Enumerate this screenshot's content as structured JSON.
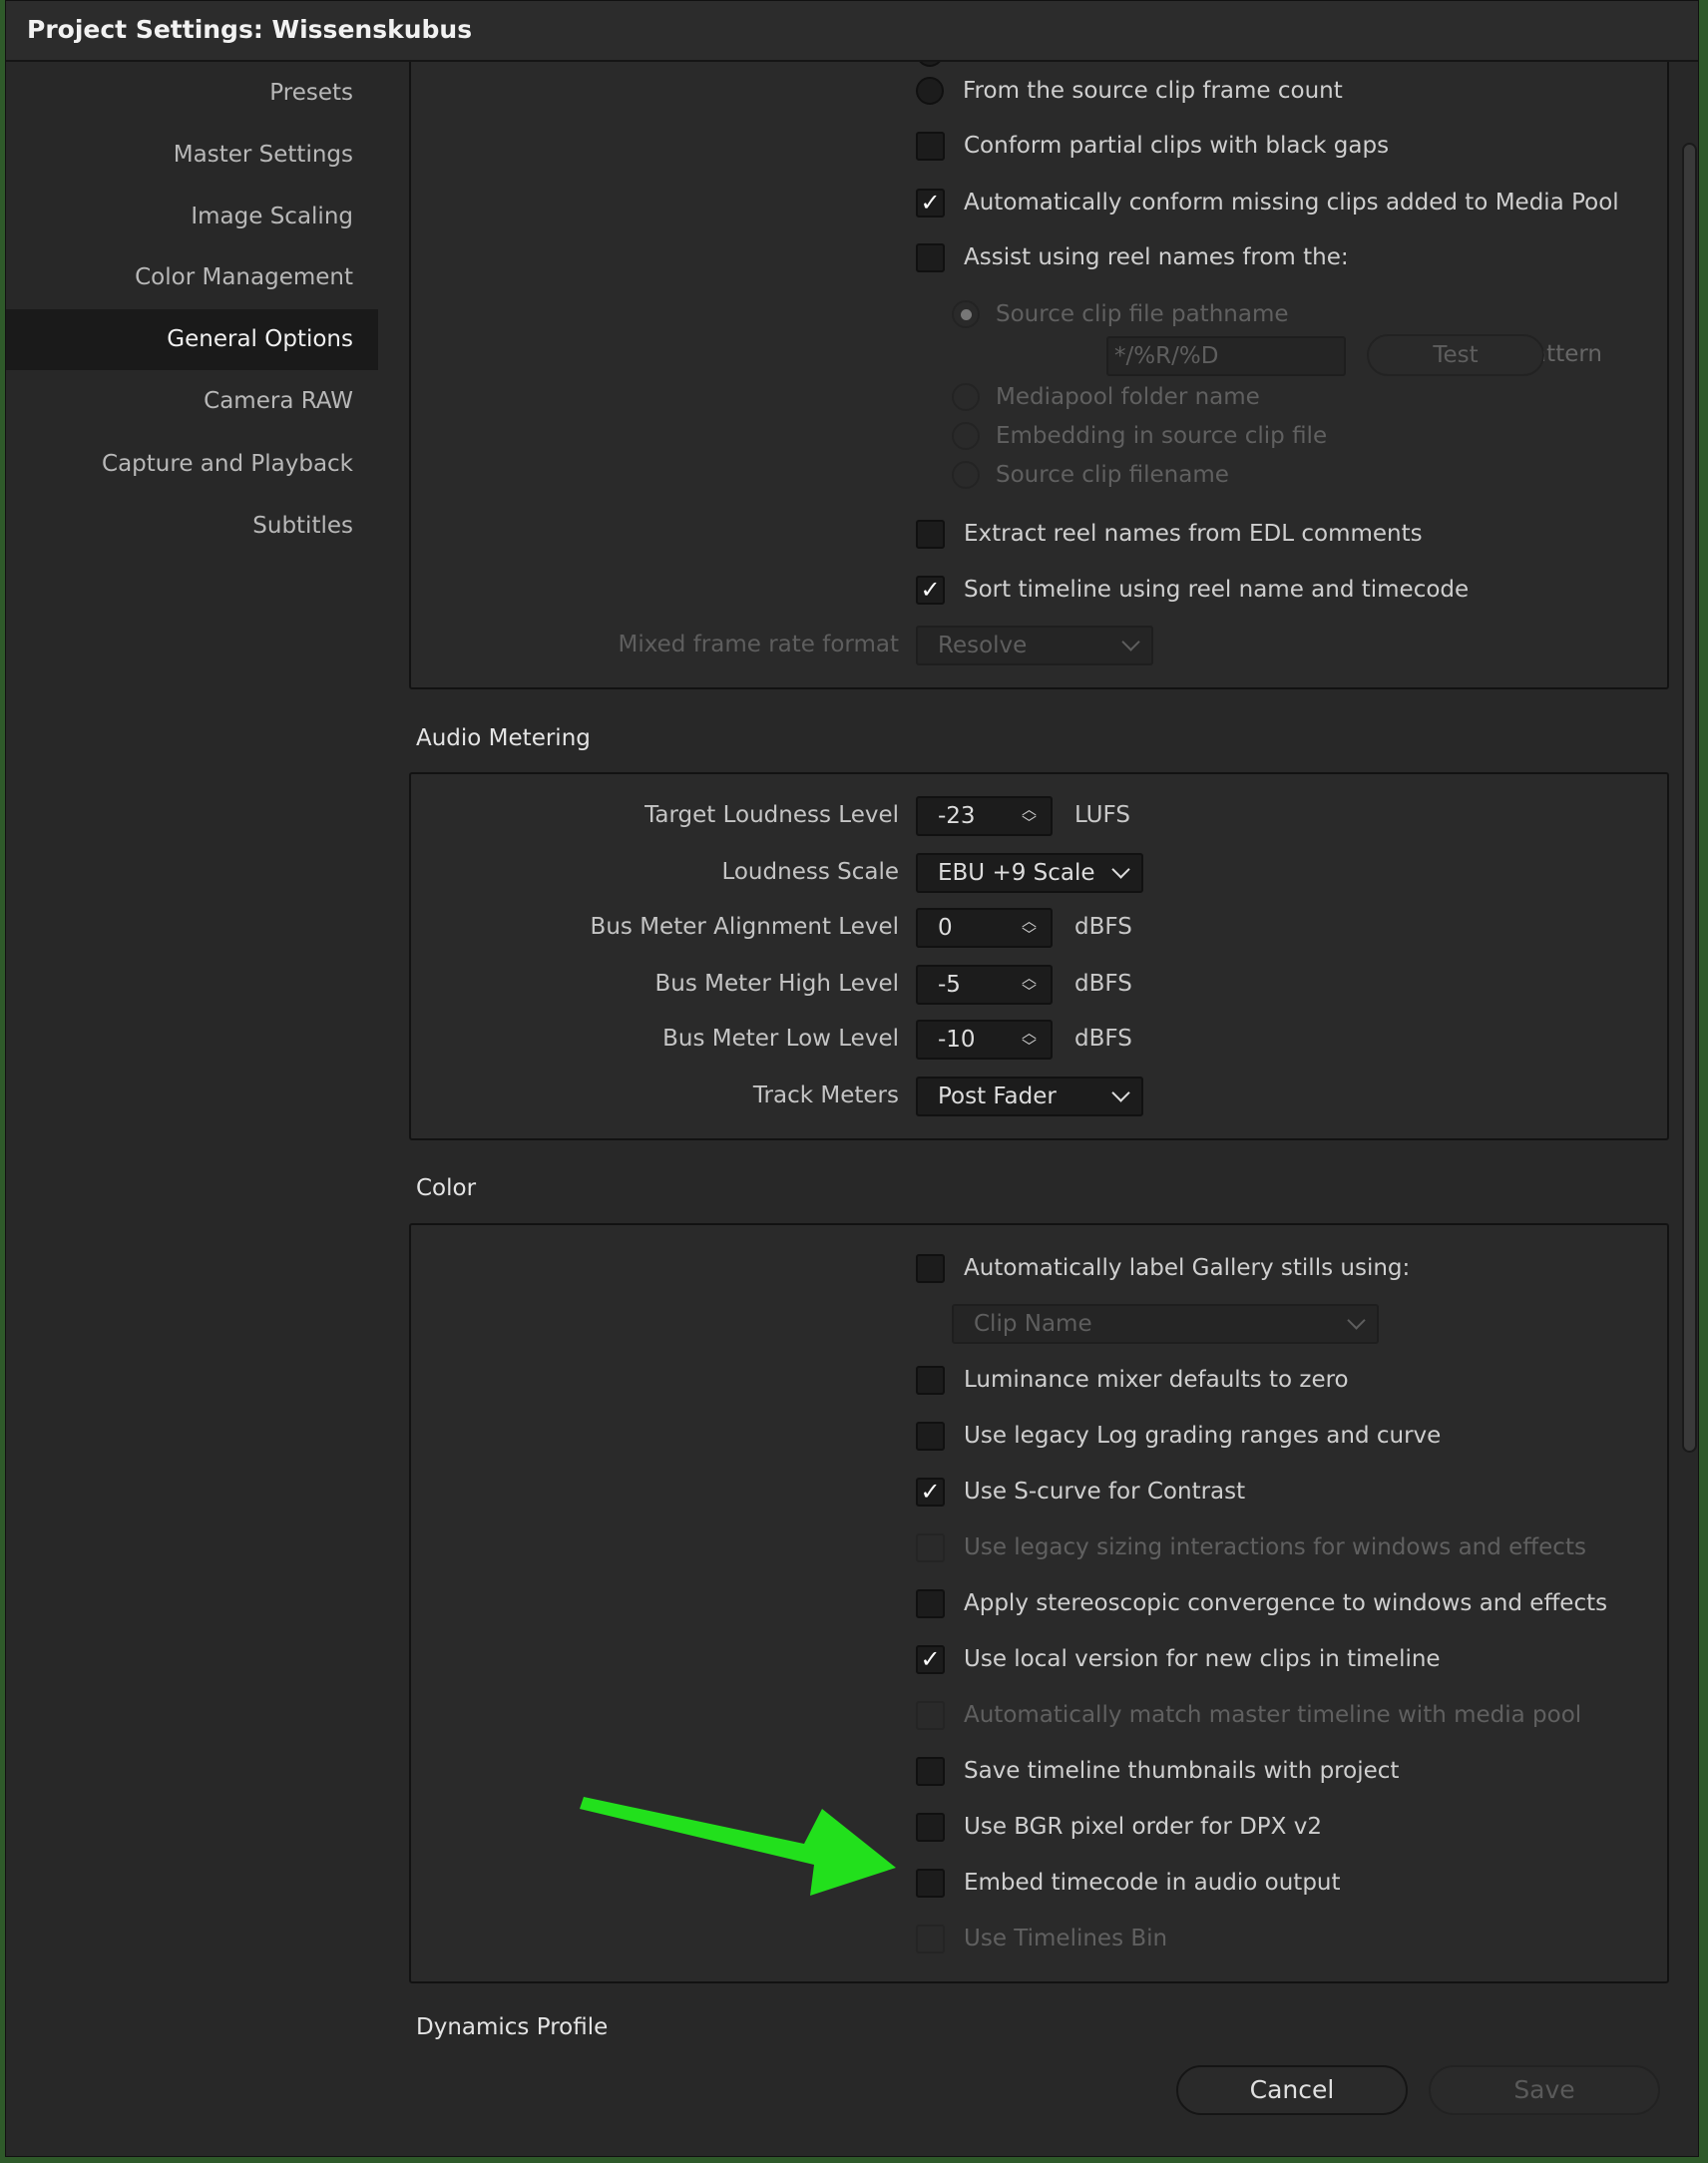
{
  "window": {
    "title": "Project Settings:  Wissenskubus"
  },
  "sidebar": {
    "selected": "General Options",
    "items": [
      {
        "label": "Presets"
      },
      {
        "label": "Master Settings"
      },
      {
        "label": "Image Scaling"
      },
      {
        "label": "Color Management"
      },
      {
        "label": "General Options"
      },
      {
        "label": "Camera RAW"
      },
      {
        "label": "Capture and Playback"
      },
      {
        "label": "Subtitles"
      }
    ]
  },
  "conform": {
    "items": [
      {
        "type": "radio",
        "label": "From the source clip frame count",
        "checked": false,
        "disabled": false
      },
      {
        "type": "checkbox",
        "label": "Conform partial clips with black gaps",
        "checked": false,
        "disabled": false
      },
      {
        "type": "checkbox",
        "label": "Automatically conform missing clips added to Media Pool",
        "checked": true,
        "disabled": false
      },
      {
        "type": "checkbox",
        "label": "Assist using reel names from the:",
        "checked": false,
        "disabled": false
      },
      {
        "type": "subradio",
        "label": "Source clip file pathname",
        "checked": true,
        "disabled": true
      },
      {
        "type": "subradio",
        "label": "Mediapool folder name",
        "checked": false,
        "disabled": true
      },
      {
        "type": "subradio",
        "label": "Embedding in source clip file",
        "checked": false,
        "disabled": true
      },
      {
        "type": "subradio",
        "label": "Source clip filename",
        "checked": false,
        "disabled": true
      },
      {
        "type": "checkbox",
        "label": "Extract reel names from EDL comments",
        "checked": false,
        "disabled": false
      },
      {
        "type": "checkbox",
        "label": "Sort timeline using reel name and timecode",
        "checked": true,
        "disabled": false
      }
    ],
    "pattern_label": "Pattern",
    "pattern_value": "*/%R/%D",
    "test_label": "Test",
    "mixed_frame_rate_label": "Mixed frame rate format",
    "mixed_frame_rate_value": "Resolve"
  },
  "audio_metering": {
    "heading": "Audio Metering",
    "fields": [
      {
        "label": "Target Loudness Level",
        "type": "spin",
        "value": "-23",
        "unit": "LUFS"
      },
      {
        "label": "Loudness Scale",
        "type": "select",
        "value": "EBU +9 Scale"
      },
      {
        "label": "Bus Meter Alignment Level",
        "type": "spin",
        "value": "0",
        "unit": "dBFS"
      },
      {
        "label": "Bus Meter High Level",
        "type": "spin",
        "value": "-5",
        "unit": "dBFS"
      },
      {
        "label": "Bus Meter Low Level",
        "type": "spin",
        "value": "-10",
        "unit": "dBFS"
      },
      {
        "label": "Track Meters",
        "type": "select",
        "value": "Post Fader"
      }
    ]
  },
  "color": {
    "heading": "Color",
    "gallery_select_value": "Clip Name",
    "items": [
      {
        "label": "Automatically label Gallery stills using:",
        "checked": false,
        "disabled": false
      },
      {
        "label": "Luminance mixer defaults to zero",
        "checked": false,
        "disabled": false
      },
      {
        "label": "Use legacy Log grading ranges and curve",
        "checked": false,
        "disabled": false
      },
      {
        "label": "Use S-curve for Contrast",
        "checked": true,
        "disabled": false
      },
      {
        "label": "Use legacy sizing interactions for windows and effects",
        "checked": false,
        "disabled": true
      },
      {
        "label": "Apply stereoscopic convergence to windows and effects",
        "checked": false,
        "disabled": false
      },
      {
        "label": "Use local version for new clips in timeline",
        "checked": true,
        "disabled": false
      },
      {
        "label": "Automatically match master timeline with media pool",
        "checked": false,
        "disabled": true
      },
      {
        "label": "Save timeline thumbnails with project",
        "checked": false,
        "disabled": false
      },
      {
        "label": "Use BGR pixel order for DPX v2",
        "checked": false,
        "disabled": false
      },
      {
        "label": "Embed timecode in audio output",
        "checked": false,
        "disabled": false
      },
      {
        "label": "Use Timelines Bin",
        "checked": false,
        "disabled": true
      }
    ]
  },
  "dynamics": {
    "heading": "Dynamics Profile"
  },
  "footer": {
    "cancel_label": "Cancel",
    "save_label": "Save"
  },
  "annotation": {
    "arrow_color": "#22e01c",
    "points_to": "Embed timecode in audio output"
  }
}
